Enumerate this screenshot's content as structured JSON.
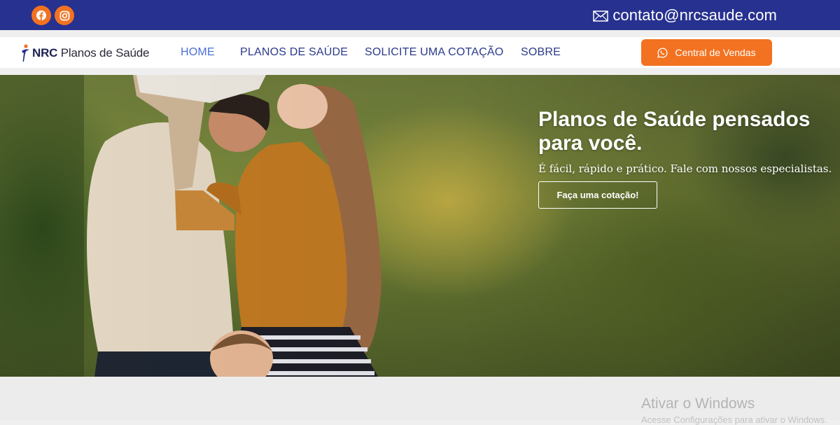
{
  "topbar": {
    "background_color": "#27318f",
    "social": [
      {
        "name": "Facebook",
        "icon": "facebook-icon"
      },
      {
        "name": "Instagram",
        "icon": "instagram-icon"
      }
    ],
    "contact_email": "contato@nrcsaude.com",
    "contact_icon": "envelope-icon"
  },
  "brand": {
    "logo_bold": "NRC",
    "logo_rest": " Planos de Saúde"
  },
  "nav": {
    "items": [
      {
        "label": "HOME",
        "active": true
      },
      {
        "label": "PLANOS DE SAÚDE",
        "active": false
      },
      {
        "label": "SOLICITE UMA COTAÇÃO",
        "active": false
      },
      {
        "label": "SOBRE",
        "active": false
      }
    ],
    "cta_label": "Central de Vendas",
    "cta_icon": "whatsapp-icon",
    "accent_color": "#f27221"
  },
  "hero": {
    "title": "Planos de Saúde pensados para você.",
    "subtitle": "É fácil, rápido e prático. Fale com nossos especialistas.",
    "button_label": "Faça uma cotação!"
  },
  "watermark": {
    "title": "Ativar o Windows",
    "subtitle": "Acesse Configurações para ativar o Windows."
  }
}
